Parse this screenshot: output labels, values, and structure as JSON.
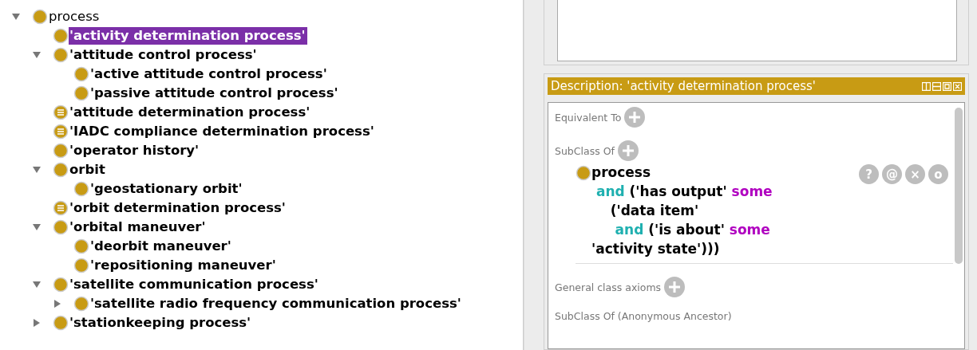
{
  "tree": [
    {
      "label": "process",
      "kind": "class",
      "expanded": true,
      "selected": false,
      "children": [
        {
          "label": "'activity determination process'",
          "kind": "class",
          "selected": true
        },
        {
          "label": "'attitude control process'",
          "kind": "class",
          "expanded": true,
          "selected": false,
          "children": [
            {
              "label": "'active attitude control process'",
              "kind": "class",
              "selected": false
            },
            {
              "label": "'passive attitude control process'",
              "kind": "class",
              "selected": false
            }
          ]
        },
        {
          "label": "'attitude determination process'",
          "kind": "defined",
          "selected": false
        },
        {
          "label": "'IADC compliance determination process'",
          "kind": "defined",
          "selected": false
        },
        {
          "label": "'operator history'",
          "kind": "class",
          "selected": false
        },
        {
          "label": "orbit",
          "kind": "class",
          "expanded": true,
          "selected": false,
          "children": [
            {
              "label": "'geostationary orbit'",
              "kind": "class",
              "selected": false
            }
          ]
        },
        {
          "label": "'orbit determination process'",
          "kind": "defined",
          "selected": false
        },
        {
          "label": "'orbital maneuver'",
          "kind": "class",
          "expanded": true,
          "selected": false,
          "children": [
            {
              "label": "'deorbit maneuver'",
              "kind": "class",
              "selected": false
            },
            {
              "label": "'repositioning maneuver'",
              "kind": "class",
              "selected": false
            }
          ]
        },
        {
          "label": "'satellite communication process'",
          "kind": "class",
          "expanded": true,
          "selected": false,
          "children": [
            {
              "label": "'satellite radio frequency communication process'",
              "kind": "class",
              "expanded": false,
              "selected": false
            }
          ]
        },
        {
          "label": "'stationkeeping process'",
          "kind": "class",
          "expanded": false,
          "selected": false
        }
      ]
    }
  ],
  "description": {
    "title": "Description: 'activity determination process'",
    "sections": [
      {
        "label": "Equivalent To"
      },
      {
        "label": "SubClass Of",
        "expression": {
          "lines": [
            [
              {
                "text": "process",
                "kind": "name"
              }
            ],
            [
              {
                "text": " and",
                "kind": "keyword"
              },
              {
                "text": " ('has output' ",
                "kind": "name"
              },
              {
                "text": "some",
                "kind": "quantifier"
              }
            ],
            [
              {
                "text": "    ('data item'",
                "kind": "name"
              }
            ],
            [
              {
                "text": "     and",
                "kind": "keyword"
              },
              {
                "text": " ('is about' ",
                "kind": "name"
              },
              {
                "text": "some",
                "kind": "quantifier"
              }
            ],
            [
              {
                "text": "'activity state')))",
                "kind": "name"
              }
            ]
          ],
          "buttons": [
            "?",
            "@",
            "×",
            "o"
          ]
        }
      },
      {
        "label": "General class axioms"
      },
      {
        "label": "SubClass Of (Anonymous Ancestor)"
      }
    ]
  }
}
